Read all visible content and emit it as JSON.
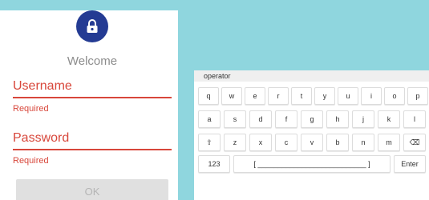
{
  "login": {
    "welcome": "Welcome",
    "username_placeholder": "Username",
    "username_error": "Required",
    "password_placeholder": "Password",
    "password_error": "Required",
    "ok_label": "OK",
    "lock_icon": "lock-icon"
  },
  "keyboard": {
    "input_text": "operator",
    "row1": [
      "q",
      "w",
      "e",
      "r",
      "t",
      "y",
      "u",
      "i",
      "o",
      "p"
    ],
    "row2": [
      "a",
      "s",
      "d",
      "f",
      "g",
      "h",
      "j",
      "k",
      "l"
    ],
    "row3": [
      "⇧",
      "z",
      "x",
      "c",
      "v",
      "b",
      "n",
      "m",
      "⌫"
    ],
    "row4": [
      "123",
      "[ ___________________________ ]",
      "Enter"
    ]
  },
  "colors": {
    "background": "#8fd6de",
    "accent_error": "#d8473b",
    "lock_badge": "#243b93"
  }
}
